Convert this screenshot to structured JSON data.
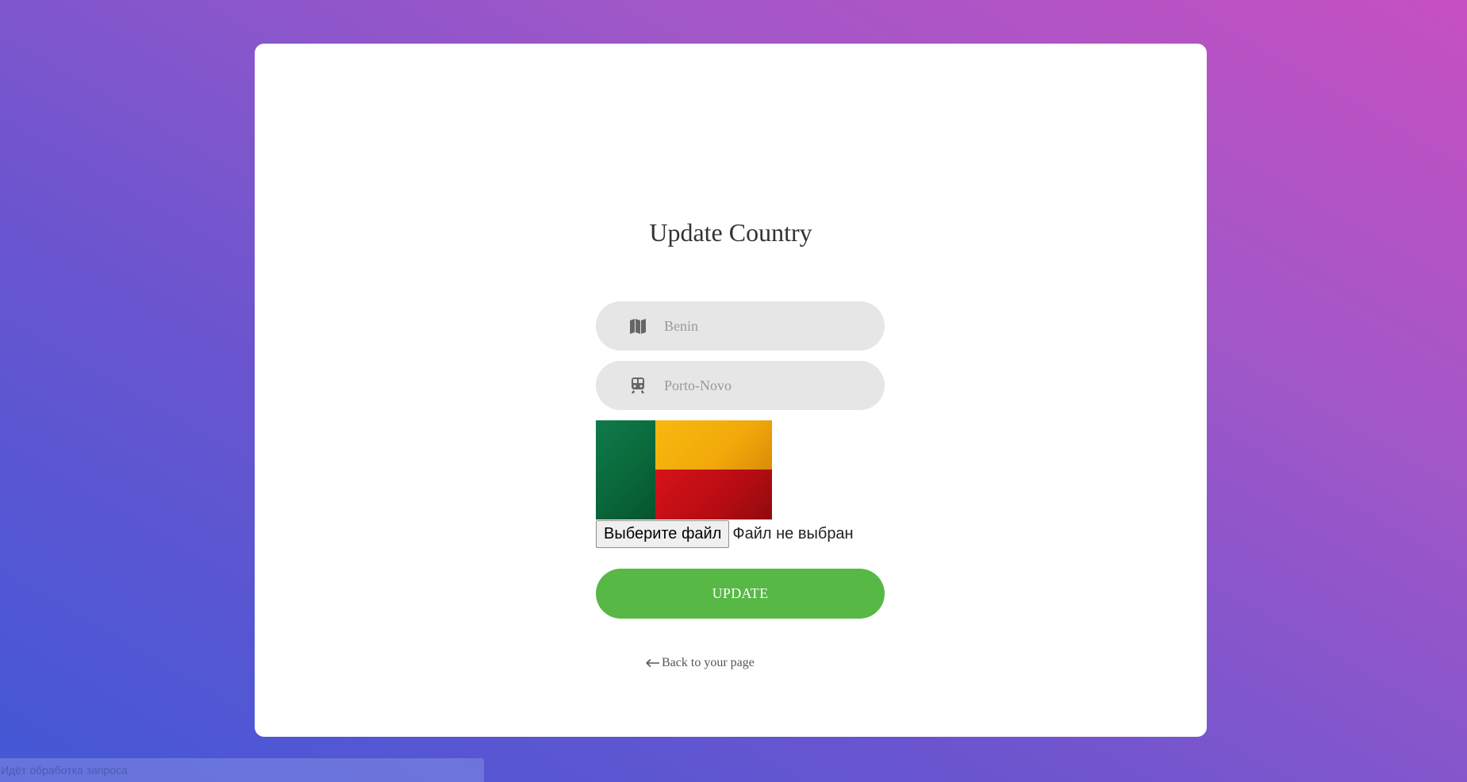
{
  "form": {
    "title": "Update Country",
    "country": {
      "placeholder": "Benin",
      "value": "",
      "icon": "map-icon"
    },
    "capital": {
      "placeholder": "Porto-Novo",
      "value": "",
      "icon": "train-icon"
    },
    "flag": {
      "country": "Benin",
      "colors": {
        "green": "#0a6a3c",
        "yellow": "#f2a90a",
        "red": "#b60c12"
      }
    },
    "file_input": {
      "button_label": "Выберите файл",
      "status": "Файл не выбран"
    },
    "submit_label": "UPDATE",
    "back_link": {
      "label": "Back to your page",
      "icon": "arrow-left-icon"
    }
  },
  "browser_status": "Идёт обработка запроса",
  "colors": {
    "accent": "#57b846",
    "input_bg": "#e6e6e6",
    "bg_gradient_start": "#4358d6",
    "bg_gradient_end": "#c650c2"
  }
}
